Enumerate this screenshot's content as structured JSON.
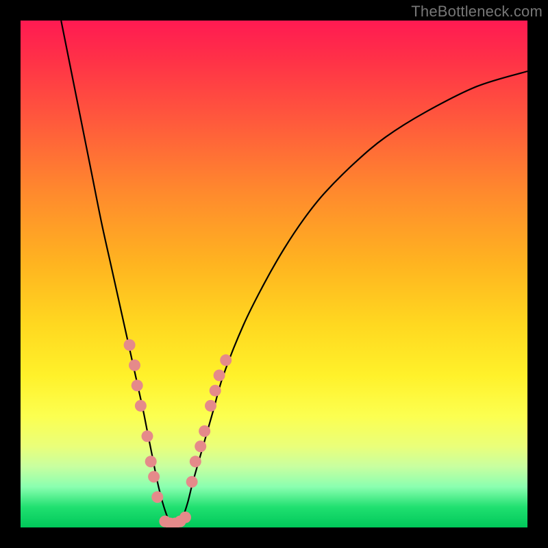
{
  "watermark": "TheBottleneck.com",
  "colors": {
    "curve_stroke": "#000000",
    "marker_fill": "#e58a8a",
    "marker_stroke": "#c76a6a",
    "frame": "#000000"
  },
  "chart_data": {
    "type": "line",
    "title": "",
    "xlabel": "",
    "ylabel": "",
    "xlim": [
      0,
      100
    ],
    "ylim": [
      0,
      100
    ],
    "grid": false,
    "legend": false,
    "series": [
      {
        "name": "bottleneck-curve",
        "x": [
          8,
          10,
          12,
          14,
          16,
          18,
          20,
          22,
          24,
          25,
          26,
          27,
          28,
          29,
          30,
          31,
          32,
          33,
          34,
          36,
          38,
          40,
          44,
          48,
          52,
          56,
          60,
          66,
          72,
          80,
          90,
          100
        ],
        "y": [
          100,
          90,
          80,
          70,
          60,
          51,
          42,
          33,
          24,
          19,
          14,
          9,
          5,
          2,
          0,
          0,
          2,
          5,
          9,
          16,
          23,
          30,
          40,
          48,
          55,
          61,
          66,
          72,
          77,
          82,
          87,
          90
        ]
      }
    ],
    "markers": {
      "left": [
        {
          "x": 21.5,
          "y": 36
        },
        {
          "x": 22.5,
          "y": 32
        },
        {
          "x": 23.0,
          "y": 28
        },
        {
          "x": 23.7,
          "y": 24
        },
        {
          "x": 25.0,
          "y": 18
        },
        {
          "x": 25.7,
          "y": 13
        },
        {
          "x": 26.3,
          "y": 10
        },
        {
          "x": 27.0,
          "y": 6
        }
      ],
      "right": [
        {
          "x": 33.8,
          "y": 9
        },
        {
          "x": 34.5,
          "y": 13
        },
        {
          "x": 35.5,
          "y": 16
        },
        {
          "x": 36.3,
          "y": 19
        },
        {
          "x": 37.5,
          "y": 24
        },
        {
          "x": 38.4,
          "y": 27
        },
        {
          "x": 39.2,
          "y": 30
        },
        {
          "x": 40.5,
          "y": 33
        }
      ],
      "bottom": [
        {
          "x": 28.5,
          "y": 1.2
        },
        {
          "x": 29.5,
          "y": 0.8
        },
        {
          "x": 30.5,
          "y": 0.8
        },
        {
          "x": 31.5,
          "y": 1.2
        },
        {
          "x": 32.5,
          "y": 2.0
        }
      ]
    }
  }
}
